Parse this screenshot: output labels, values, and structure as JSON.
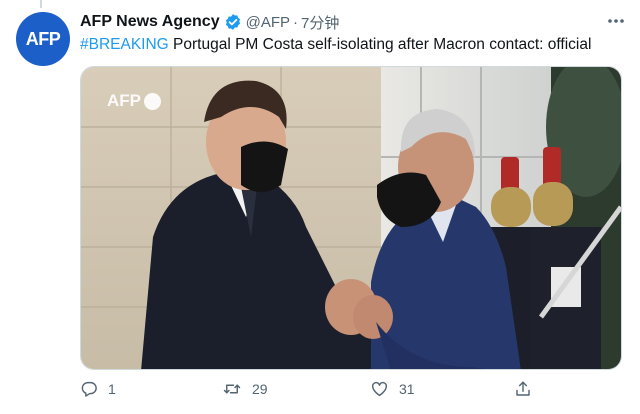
{
  "tweet": {
    "avatar_text": "AFP",
    "display_name": "AFP News Agency",
    "handle": "@AFP",
    "separator": "·",
    "timestamp": "7分钟",
    "hashtag": "#BREAKING",
    "text": " Portugal PM Costa self-isolating after Macron contact: official",
    "media_watermark": "AFP"
  },
  "actions": {
    "reply_count": "1",
    "retweet_count": "29",
    "like_count": "31"
  },
  "colors": {
    "link": "#1d9bf0",
    "avatar_bg": "#1d5fc9",
    "secondary_text": "#536471",
    "verified": "#1d9bf0"
  },
  "icons": [
    "verified-badge-icon",
    "more-options-icon",
    "reply-icon",
    "retweet-icon",
    "like-icon",
    "share-icon"
  ]
}
